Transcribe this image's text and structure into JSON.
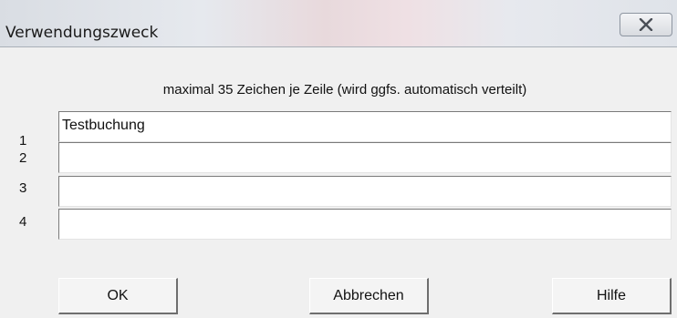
{
  "window": {
    "title": "Verwendungszweck",
    "close_icon": "close-icon"
  },
  "dialog": {
    "hint": "maximal 35 Zeichen je Zeile (wird ggfs. automatisch verteilt)",
    "lines": [
      {
        "number": "1",
        "value": "Testbuchung"
      },
      {
        "number": "2",
        "value": ""
      },
      {
        "number": "3",
        "value": ""
      },
      {
        "number": "4",
        "value": ""
      }
    ],
    "buttons": {
      "ok": "OK",
      "cancel": "Abbrechen",
      "help": "Hilfe"
    }
  }
}
